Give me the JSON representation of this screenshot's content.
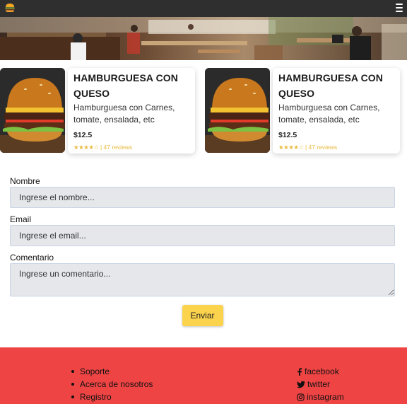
{
  "header": {
    "logo_icon": "burger-logo-icon",
    "menu_icon": "hamburger-menu-icon"
  },
  "cards": [
    {
      "title": "HAMBURGUESA CON QUESO",
      "description": "Hamburguesa con Carnes, tomate, ensalada, etc",
      "price": "$12.5",
      "stars": "★★★★☆",
      "reviews": "| 47 reviews"
    },
    {
      "title": "HAMBURGUESA CON QUESO",
      "description": "Hamburguesa con Carnes, tomate, ensalada, etc",
      "price": "$12.5",
      "stars": "★★★★☆",
      "reviews": "| 47 reviews"
    }
  ],
  "form": {
    "name_label": "Nombre",
    "name_placeholder": "Ingrese el nombre...",
    "email_label": "Email",
    "email_placeholder": "Ingrese el email...",
    "comment_label": "Comentario",
    "comment_placeholder": "Ingrese un comentario...",
    "submit_label": "Enviar"
  },
  "footer": {
    "links": [
      "Soporte",
      "Acerca de nosotros",
      "Registro"
    ],
    "social": [
      {
        "icon": "facebook-icon",
        "label": "facebook"
      },
      {
        "icon": "twitter-icon",
        "label": "twitter"
      },
      {
        "icon": "instagram-icon",
        "label": "instagram"
      }
    ]
  },
  "colors": {
    "topbar": "#2f2f2f",
    "accent_button": "#fcd34d",
    "footer": "#ef4444",
    "rating": "#e8b93a"
  }
}
